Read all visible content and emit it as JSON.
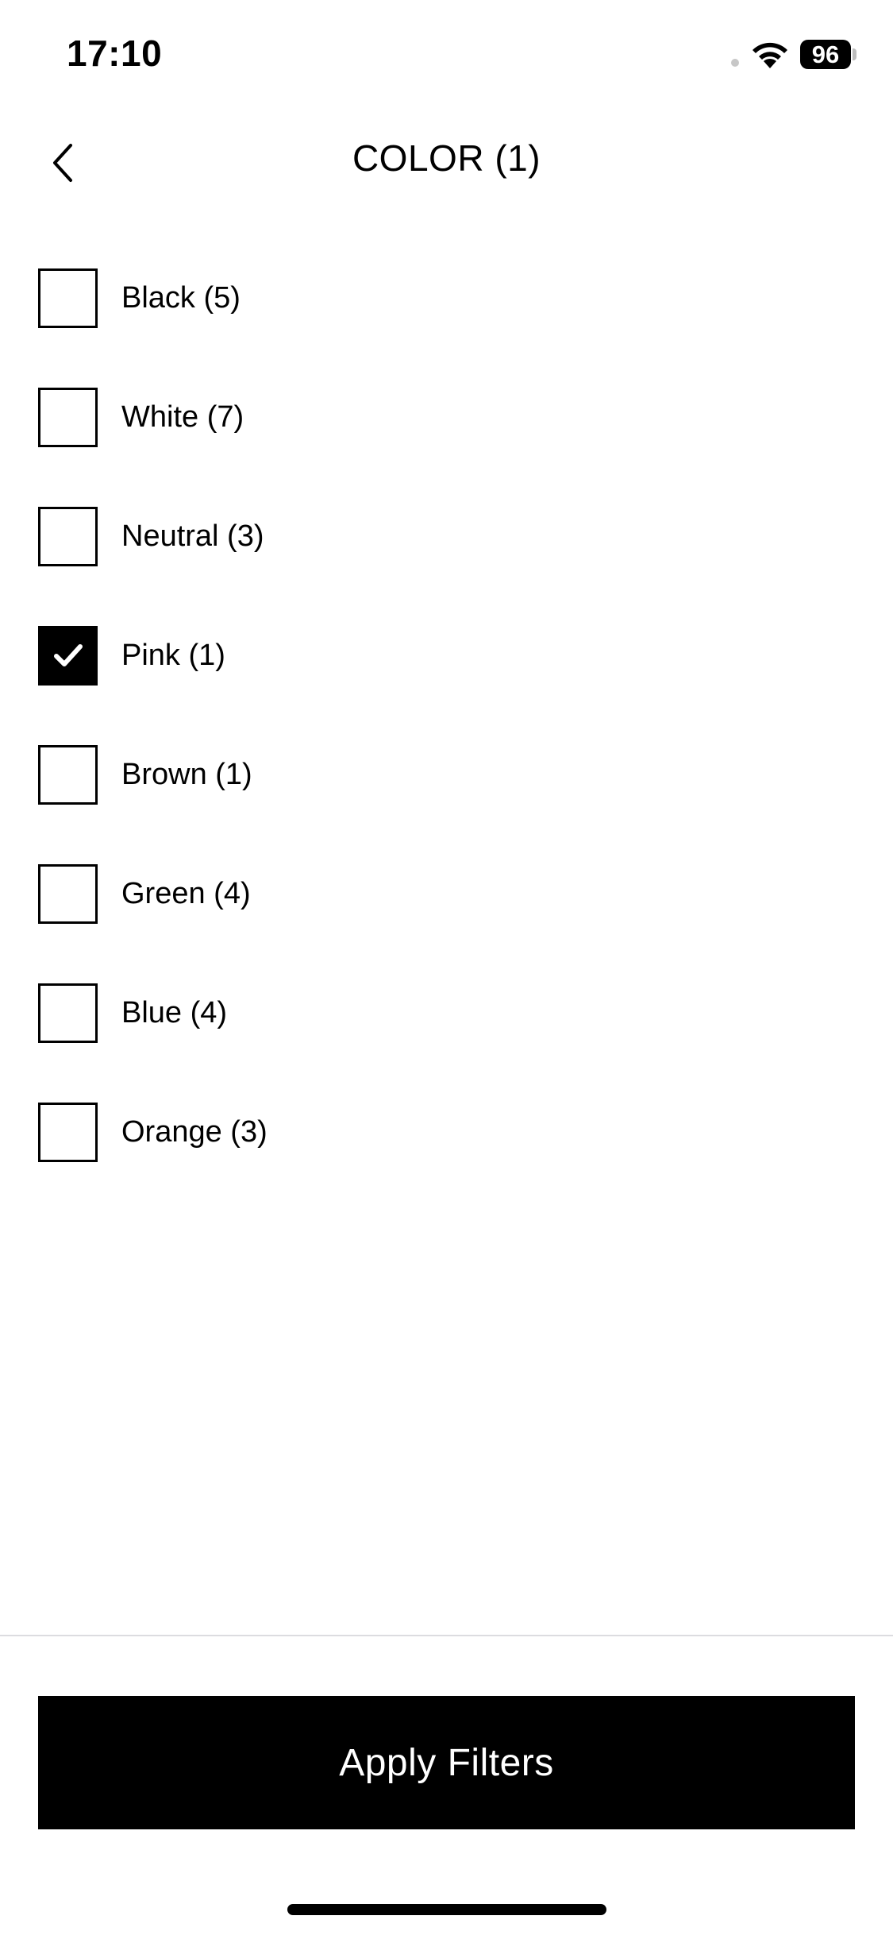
{
  "status_bar": {
    "time": "17:10",
    "battery": "96",
    "icons": [
      "wifi-icon",
      "battery-icon"
    ]
  },
  "header": {
    "title": "COLOR (1)",
    "back_icon": "chevron-left-icon"
  },
  "options": [
    {
      "label": "Black (5)",
      "checked": false
    },
    {
      "label": "White (7)",
      "checked": false
    },
    {
      "label": "Neutral (3)",
      "checked": false
    },
    {
      "label": "Pink (1)",
      "checked": true
    },
    {
      "label": "Brown (1)",
      "checked": false
    },
    {
      "label": "Green (4)",
      "checked": false
    },
    {
      "label": "Blue (4)",
      "checked": false
    },
    {
      "label": "Orange (3)",
      "checked": false
    }
  ],
  "footer": {
    "apply_label": "Apply Filters"
  },
  "colors": {
    "accent": "#000000",
    "background": "#ffffff",
    "divider": "#dcdce0"
  }
}
